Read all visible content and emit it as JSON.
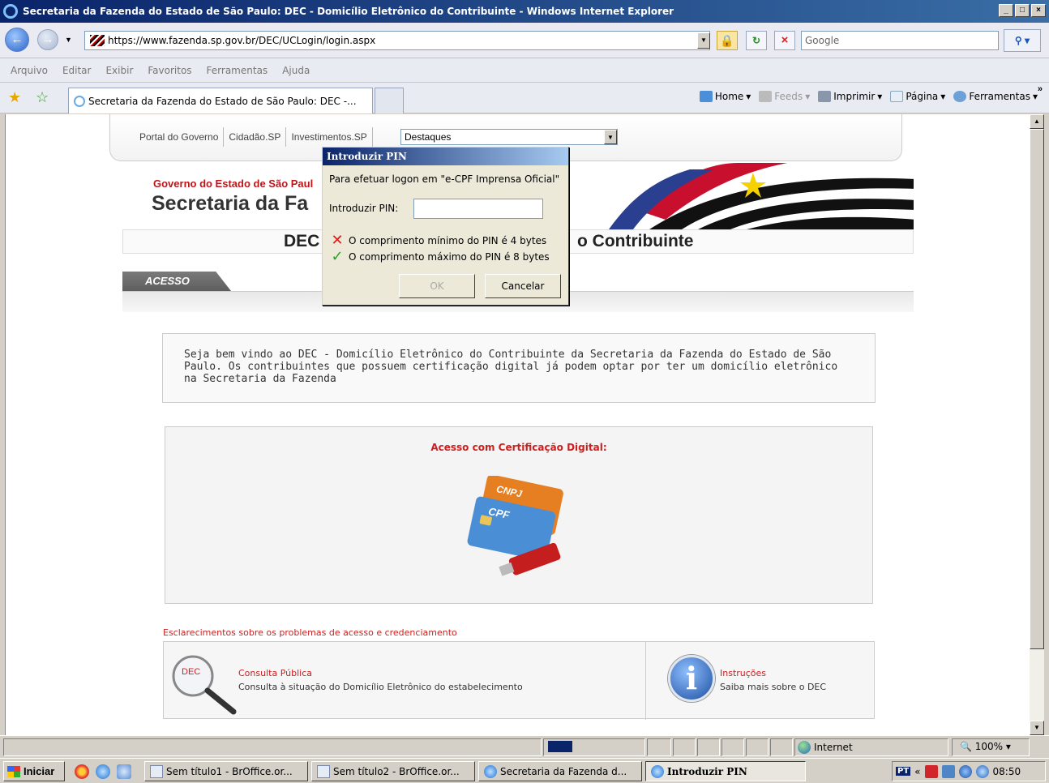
{
  "window": {
    "title": "Secretaria da Fazenda do Estado de São Paulo: DEC - Domicílio Eletrônico do Contribuinte - Windows Internet Explorer",
    "controls": [
      "_",
      "□",
      "×"
    ]
  },
  "address_bar": {
    "url": "https://www.fazenda.sp.gov.br/DEC/UCLogin/login.aspx",
    "search_placeholder": "Google"
  },
  "menu": [
    "Arquivo",
    "Editar",
    "Exibir",
    "Favoritos",
    "Ferramentas",
    "Ajuda"
  ],
  "tabs": {
    "active_label": "Secretaria da Fazenda do Estado de São Paulo: DEC -..."
  },
  "commands": {
    "home": "Home",
    "feeds": "Feeds",
    "print": "Imprimir",
    "page": "Página",
    "tools": "Ferramentas",
    "more": "»"
  },
  "page": {
    "top_links": [
      "Portal do Governo",
      "Cidadão.SP",
      "Investimentos.SP"
    ],
    "destaques": "Destaques",
    "gov_line": "Governo do Estado de São Paul",
    "sec_line": "Secretaria da Fa",
    "heading_left": "DEC",
    "heading_right": "o Contribuinte",
    "acesso_tab": "ACESSO",
    "welcome": "Seja bem vindo ao DEC - Domicílio Eletrônico do Contribuinte da Secretaria da Fazenda do Estado de São Paulo. Os contribuintes que possuem certificação digital já podem optar por ter um domicílio eletrônico na Secretaria da Fazenda",
    "cert_title": "Acesso com Certificação Digital:",
    "card_labels": [
      "CNPJ",
      "CPF"
    ],
    "esclarecimentos": "Esclarecimentos sobre os problemas de acesso e credenciamento",
    "consulta_badge": "DEC",
    "consulta_title": "Consulta Pública",
    "consulta_desc": "Consulta à situação do Domicílio Eletrônico do estabelecimento",
    "instr_title": "Instruções",
    "instr_desc": "Saiba mais sobre o DEC"
  },
  "dialog": {
    "title": "Introduzir PIN",
    "message": "Para efetuar logon em \"e-CPF Imprensa Oficial\"",
    "pin_label": "Introduzir PIN:",
    "pin_value": "",
    "rule_min": "O comprimento mínimo do PIN é 4 bytes",
    "rule_max": "O comprimento máximo do PIN é 8 bytes",
    "ok": "OK",
    "cancel": "Cancelar"
  },
  "status": {
    "zone": "Internet",
    "zoom": "100%"
  },
  "taskbar": {
    "start": "Iniciar",
    "items": [
      "Sem título1 - BrOffice.or...",
      "Sem título2 - BrOffice.or...",
      "Secretaria da Fazenda d...",
      "Introduzir PIN"
    ],
    "lang": "PT",
    "tray_arrow": "«",
    "clock": "08:50"
  },
  "colors": {
    "title_blue": "#0a246a",
    "accent_red": "#cc1f1f"
  }
}
